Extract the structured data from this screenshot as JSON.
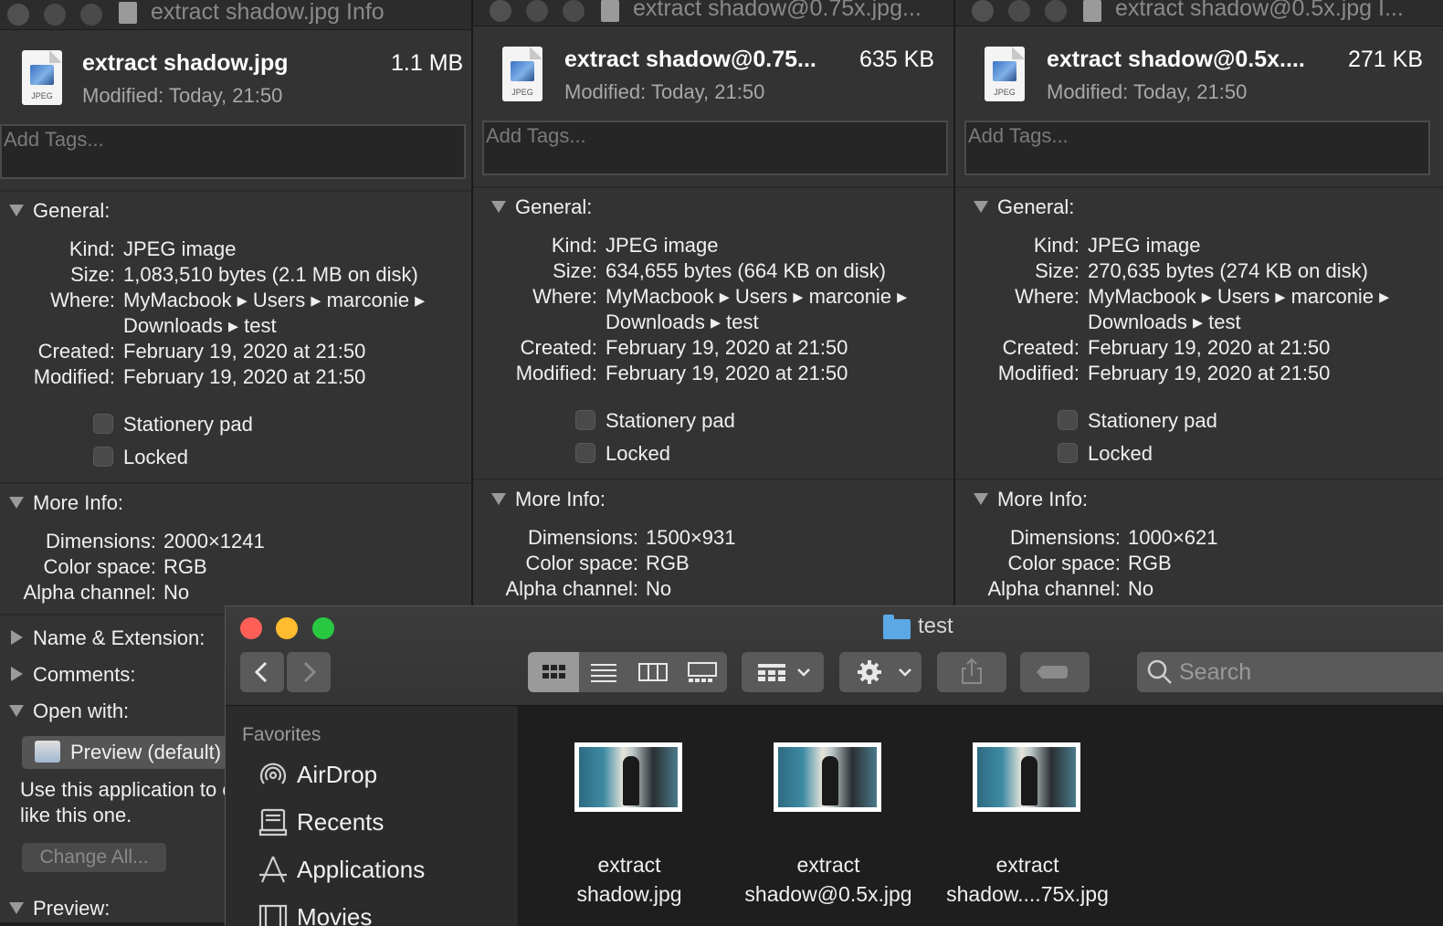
{
  "info_windows": [
    {
      "title": "extract shadow.jpg Info",
      "name": "extract shadow.jpg",
      "size": "1.1 MB",
      "modified_short": "Modified: Today, 21:50",
      "icon_ext": "JPEG",
      "tags_placeholder": "Add Tags...",
      "general_label": "General:",
      "kind_label": "Kind:",
      "kind": "JPEG image",
      "size_label": "Size:",
      "size_detail": "1,083,510 bytes (2.1 MB on disk)",
      "where_label": "Where:",
      "where_1": "MyMacbook ▸ Users ▸ marconie ▸",
      "where_2": "Downloads ▸ test",
      "created_label": "Created:",
      "created": "February 19, 2020 at 21:50",
      "modified_label": "Modified:",
      "modified": "February 19, 2020 at 21:50",
      "stationery": "Stationery pad",
      "locked": "Locked",
      "more_info_label": "More Info:",
      "dimensions_label": "Dimensions:",
      "dimensions": "2000×1241",
      "colorspace_label": "Color space:",
      "colorspace": "RGB",
      "alpha_label": "Alpha channel:",
      "alpha": "No",
      "name_ext_label": "Name & Extension:",
      "comments_label": "Comments:",
      "open_with_label": "Open with:",
      "open_with_app": "Preview (default)",
      "use_app_text_1": "Use this application to open all documents",
      "use_app_text_2": "like this one.",
      "change_all": "Change All...",
      "preview_label": "Preview:"
    },
    {
      "title": "extract shadow@0.75x.jpg...",
      "name": "extract shadow@0.75...",
      "size": "635 KB",
      "modified_short": "Modified: Today, 21:50",
      "icon_ext": "JPEG",
      "tags_placeholder": "Add Tags...",
      "general_label": "General:",
      "kind_label": "Kind:",
      "kind": "JPEG image",
      "size_label": "Size:",
      "size_detail": "634,655 bytes (664 KB on disk)",
      "where_label": "Where:",
      "where_1": "MyMacbook ▸ Users ▸ marconie ▸",
      "where_2": "Downloads ▸ test",
      "created_label": "Created:",
      "created": "February 19, 2020 at 21:50",
      "modified_label": "Modified:",
      "modified": "February 19, 2020 at 21:50",
      "stationery": "Stationery pad",
      "locked": "Locked",
      "more_info_label": "More Info:",
      "dimensions_label": "Dimensions:",
      "dimensions": "1500×931",
      "colorspace_label": "Color space:",
      "colorspace": "RGB",
      "alpha_label": "Alpha channel:",
      "alpha": "No"
    },
    {
      "title": "extract shadow@0.5x.jpg I...",
      "name": "extract shadow@0.5x....",
      "size": "271 KB",
      "modified_short": "Modified: Today, 21:50",
      "icon_ext": "JPEG",
      "tags_placeholder": "Add Tags...",
      "general_label": "General:",
      "kind_label": "Kind:",
      "kind": "JPEG image",
      "size_label": "Size:",
      "size_detail": "270,635 bytes (274 KB on disk)",
      "where_label": "Where:",
      "where_1": "MyMacbook ▸ Users ▸ marconie ▸",
      "where_2": "Downloads ▸ test",
      "created_label": "Created:",
      "created": "February 19, 2020 at 21:50",
      "modified_label": "Modified:",
      "modified": "February 19, 2020 at 21:50",
      "stationery": "Stationery pad",
      "locked": "Locked",
      "more_info_label": "More Info:",
      "dimensions_label": "Dimensions:",
      "dimensions": "1000×621",
      "colorspace_label": "Color space:",
      "colorspace": "RGB",
      "alpha_label": "Alpha channel:",
      "alpha": "No"
    }
  ],
  "finder": {
    "title": "test",
    "search_placeholder": "Search",
    "sidebar_heading": "Favorites",
    "sidebar_items": [
      {
        "label": "AirDrop",
        "icon": "airdrop-icon"
      },
      {
        "label": "Recents",
        "icon": "recents-icon"
      },
      {
        "label": "Applications",
        "icon": "applications-icon"
      },
      {
        "label": "Movies",
        "icon": "movies-icon"
      }
    ],
    "files": [
      {
        "line1": "extract",
        "line2": "shadow.jpg"
      },
      {
        "line1": "extract",
        "line2": "shadow@0.5x.jpg"
      },
      {
        "line1": "extract",
        "line2": "shadow....75x.jpg"
      }
    ],
    "colors": {
      "close": "#ff5f57",
      "minimize": "#febc2e",
      "zoom": "#28c840",
      "folder": "#5aa8e6"
    }
  }
}
